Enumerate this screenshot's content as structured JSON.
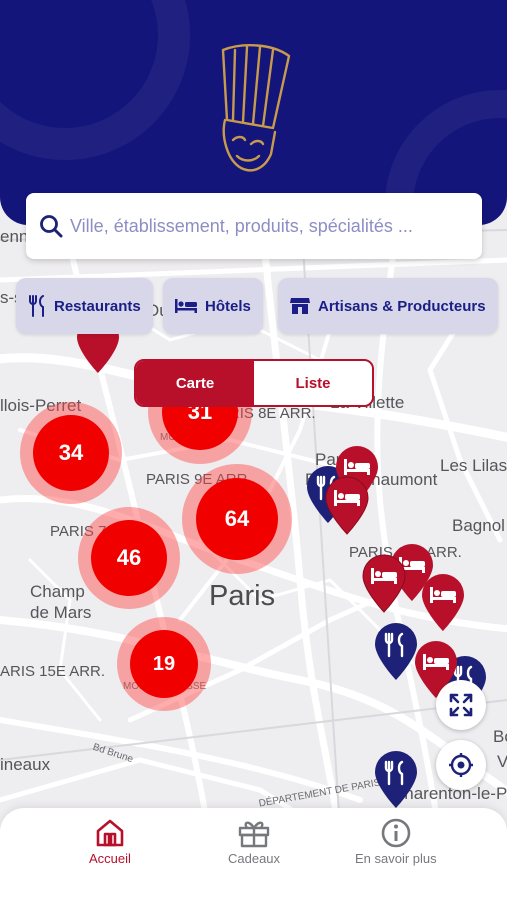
{
  "search": {
    "placeholder": "Ville, établissement, produits, spécialités ..."
  },
  "filters": [
    {
      "label": "Restaurants",
      "icon": "fork-knife-icon"
    },
    {
      "label": "Hôtels",
      "icon": "bed-icon"
    },
    {
      "label": "Artisans & Producteurs",
      "icon": "shop-icon"
    }
  ],
  "view_toggle": {
    "map_label": "Carte",
    "list_label": "Liste",
    "selected": "Carte"
  },
  "map_labels": {
    "levallois": "llois-Perret",
    "la_villette": "La Villette",
    "paris_8": "PARIS 8E ARR.",
    "paris_9": "PARIS 9E ARR.",
    "paris_19_top": "Paris",
    "buttes_chaumont": "Buttes-Chaumont",
    "les_lilas": "Les Lilas",
    "bagnolet": "Bagnol",
    "paris_7": "PARIS 7",
    "paris_11": "PARIS 11E ARR.",
    "champ_de_mars": "Champ\nde Mars",
    "paris_city": "Paris",
    "paris_15": "ARIS 15E ARR.",
    "montparnasse": "MONTPARNASSE",
    "moulineaux": "ineaux",
    "bd_brune": "Bd Brune",
    "charenton": "Charenton-le-P",
    "bois": "Bo",
    "val": "V",
    "gennevilliers": "enne",
    "asnieres": "s-s",
    "departement": "DÉPARTEMENT DE PARIS",
    "ou": "Ou",
    "mo": "MO"
  },
  "clusters": [
    {
      "count": "31"
    },
    {
      "count": "34"
    },
    {
      "count": "64"
    },
    {
      "count": "46"
    },
    {
      "count": "19"
    }
  ],
  "nav": {
    "home_label": "Accueil",
    "gifts_label": "Cadeaux",
    "info_label": "En savoir plus",
    "active": "Accueil"
  },
  "colors": {
    "header_navy": "#13157a",
    "brand_red": "#b8102b",
    "cluster_red": "#f10000",
    "hotel_pin": "#b8102b",
    "restaurant_pin": "#1d2278",
    "chip_bg": "#d7d7e9",
    "chip_text": "#1b1e86",
    "logo_gold": "#c89a4e"
  }
}
